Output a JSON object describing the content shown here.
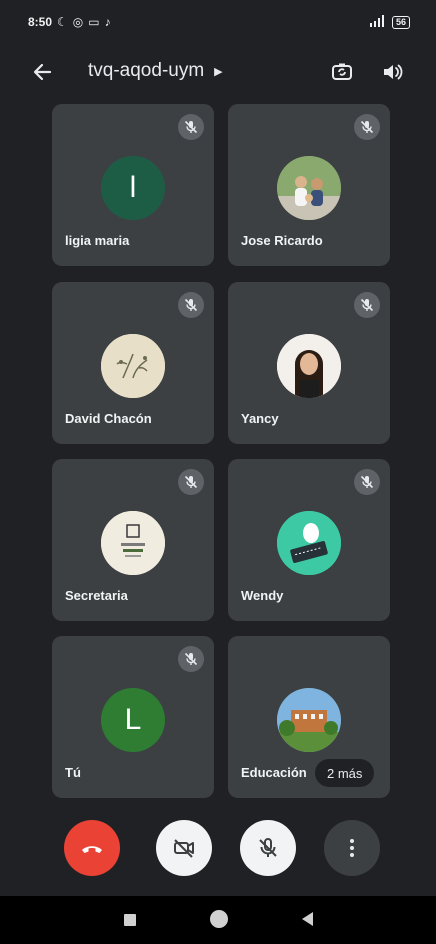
{
  "status_bar": {
    "time": "8:50",
    "signal": "4G",
    "battery": "56"
  },
  "header": {
    "meeting_code": "tvq-aqod-uym"
  },
  "participants": [
    {
      "name": "ligia maria",
      "initial": "l",
      "avatar_color": "#1e5d45"
    },
    {
      "name": "Jose Ricardo",
      "initial": "",
      "avatar_color": "#7a9a63"
    },
    {
      "name": "David Chacón",
      "initial": "",
      "avatar_color": "#e6dcc4"
    },
    {
      "name": "Yancy",
      "initial": "",
      "avatar_color": "#f4f1ee"
    },
    {
      "name": "Secretaria",
      "initial": "",
      "avatar_color": "#f1ece0"
    },
    {
      "name": "Wendy",
      "initial": "",
      "avatar_color": "#3cc9a3"
    },
    {
      "name": "Tú",
      "initial": "L",
      "avatar_color": "#2e7d32"
    },
    {
      "name": "Educación",
      "initial": "",
      "avatar_color": "#5b8f3a"
    }
  ],
  "more_pill": "2 más",
  "colors": {
    "background": "#202124",
    "tile": "#3c4043",
    "end_call": "#ea4335"
  },
  "icons": {
    "back": "arrow-left-icon",
    "switch_camera": "switch-camera-icon",
    "speaker": "speaker-icon",
    "mic_off": "mic-off-icon",
    "camera_off": "camera-off-icon",
    "end_call": "phone-hangup-icon",
    "more": "more-vert-icon"
  }
}
